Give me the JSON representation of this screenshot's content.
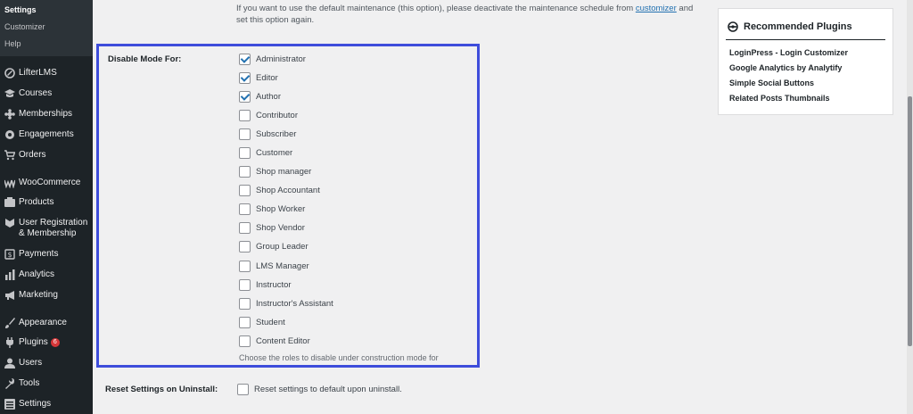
{
  "sidebar": {
    "submenu": [
      {
        "label": "Settings",
        "current": true
      },
      {
        "label": "Customizer",
        "current": false
      },
      {
        "label": "Help",
        "current": false
      }
    ],
    "items": [
      {
        "label": "LifterLMS",
        "icon": "lifterlms-icon"
      },
      {
        "label": "Courses",
        "icon": "courses-icon"
      },
      {
        "label": "Memberships",
        "icon": "memberships-icon"
      },
      {
        "label": "Engagements",
        "icon": "engagements-icon"
      },
      {
        "label": "Orders",
        "icon": "cart-icon"
      },
      {
        "label": "WooCommerce",
        "icon": "woocommerce-icon"
      },
      {
        "label": "Products",
        "icon": "products-icon"
      },
      {
        "label": "User Registration & Membership",
        "icon": "user-registration-icon"
      },
      {
        "label": "Payments",
        "icon": "payments-icon"
      },
      {
        "label": "Analytics",
        "icon": "analytics-icon"
      },
      {
        "label": "Marketing",
        "icon": "megaphone-icon"
      },
      {
        "label": "Appearance",
        "icon": "paintbrush-icon"
      },
      {
        "label": "Plugins",
        "icon": "plugins-icon",
        "badge": "6"
      },
      {
        "label": "Users",
        "icon": "users-icon"
      },
      {
        "label": "Tools",
        "icon": "wrench-icon"
      },
      {
        "label": "Settings",
        "icon": "settings-icon"
      }
    ]
  },
  "intro": {
    "text_before": "If you want to use the default maintenance (this option), please deactivate the maintenance schedule from ",
    "link": "customizer",
    "text_after": " and set this option again."
  },
  "disable_mode": {
    "label": "Disable Mode For:",
    "roles": [
      {
        "label": "Administrator",
        "checked": true
      },
      {
        "label": "Editor",
        "checked": true
      },
      {
        "label": "Author",
        "checked": true
      },
      {
        "label": "Contributor",
        "checked": false
      },
      {
        "label": "Subscriber",
        "checked": false
      },
      {
        "label": "Customer",
        "checked": false
      },
      {
        "label": "Shop manager",
        "checked": false
      },
      {
        "label": "Shop Accountant",
        "checked": false
      },
      {
        "label": "Shop Worker",
        "checked": false
      },
      {
        "label": "Shop Vendor",
        "checked": false
      },
      {
        "label": "Group Leader",
        "checked": false
      },
      {
        "label": "LMS Manager",
        "checked": false
      },
      {
        "label": "Instructor",
        "checked": false
      },
      {
        "label": "Instructor's Assistant",
        "checked": false
      },
      {
        "label": "Student",
        "checked": false
      },
      {
        "label": "Content Editor",
        "checked": false
      }
    ],
    "description": "Choose the roles to disable under construction mode for"
  },
  "reset": {
    "label": "Reset Settings on Uninstall:",
    "checkbox_label": "Reset settings to default upon uninstall.",
    "checked": false
  },
  "recommended": {
    "title": "Recommended Plugins",
    "icon": "recommended-plugins-icon",
    "plugins": [
      "LoginPress - Login Customizer",
      "Google Analytics by Analytify",
      "Simple Social Buttons",
      "Related Posts Thumbnails"
    ]
  },
  "colors": {
    "sidebar_bg": "#1d2327",
    "highlight_border": "#3e4ddb",
    "link": "#2271b1",
    "badge": "#d63638"
  }
}
